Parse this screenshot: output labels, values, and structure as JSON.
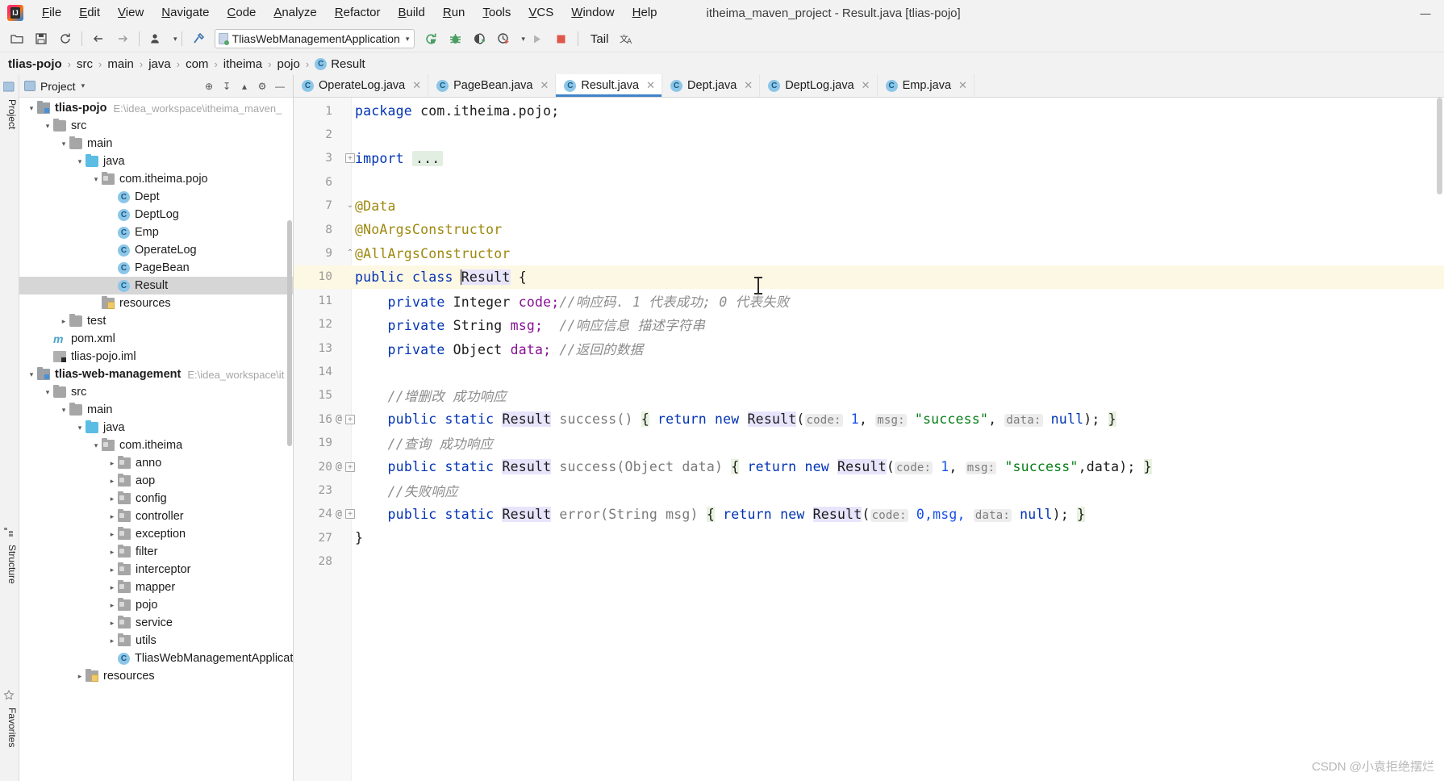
{
  "window": {
    "title": "itheima_maven_project - Result.java [tlias-pojo]",
    "controls": {
      "minimize": "—",
      "maximize": "□",
      "close": "✕"
    }
  },
  "menubar": [
    {
      "label": "File"
    },
    {
      "label": "Edit"
    },
    {
      "label": "View"
    },
    {
      "label": "Navigate"
    },
    {
      "label": "Code"
    },
    {
      "label": "Analyze"
    },
    {
      "label": "Refactor"
    },
    {
      "label": "Build"
    },
    {
      "label": "Run"
    },
    {
      "label": "Tools"
    },
    {
      "label": "VCS"
    },
    {
      "label": "Window"
    },
    {
      "label": "Help"
    }
  ],
  "toolbar": {
    "icons_left": [
      {
        "name": "open-folder-icon",
        "glyph": "📂"
      },
      {
        "name": "save-all-icon",
        "glyph": "💾"
      },
      {
        "name": "sync-refresh-icon",
        "glyph": "↻"
      },
      {
        "name": "back-icon",
        "glyph": "←"
      },
      {
        "name": "forward-icon",
        "glyph": "→"
      },
      {
        "name": "user-profile-icon",
        "glyph": "👤"
      },
      {
        "name": "build-hammer-icon",
        "glyph": "⬉"
      }
    ],
    "run_config": "TliasWebManagementApplication",
    "icons_right": [
      {
        "name": "run-arrow-icon",
        "glyph": "➳"
      },
      {
        "name": "debug-bug-icon",
        "glyph": "🐞"
      },
      {
        "name": "run-with-coverage-icon",
        "glyph": "◑"
      },
      {
        "name": "profiler-clock-icon",
        "glyph": "⒬"
      },
      {
        "name": "dropdown-caret-icon",
        "glyph": "▾"
      },
      {
        "name": "play-icon",
        "glyph": "▶"
      },
      {
        "name": "stop-square-icon",
        "glyph": "■"
      }
    ],
    "tail_label": "Tail",
    "translate_label": "文A"
  },
  "breadcrumb": [
    {
      "label": "tlias-pojo",
      "bold": true,
      "icon": null
    },
    {
      "label": "src",
      "bold": false,
      "icon": null
    },
    {
      "label": "main",
      "bold": false,
      "icon": null
    },
    {
      "label": "java",
      "bold": false,
      "icon": null
    },
    {
      "label": "com",
      "bold": false,
      "icon": null
    },
    {
      "label": "itheima",
      "bold": false,
      "icon": null
    },
    {
      "label": "pojo",
      "bold": false,
      "icon": null
    },
    {
      "label": "Result",
      "bold": false,
      "icon": "class-icon"
    }
  ],
  "left_rail": [
    {
      "label": "Project",
      "name": "rail-tab-project"
    },
    {
      "label": "Structure",
      "name": "rail-tab-structure"
    },
    {
      "label": "Favorites",
      "name": "rail-tab-favorites"
    }
  ],
  "project_panel": {
    "title": "Project",
    "header_buttons": [
      {
        "name": "locate-target-icon",
        "glyph": "⊕"
      },
      {
        "name": "collapse-all-icon",
        "glyph": "↧"
      },
      {
        "name": "expand-icon",
        "glyph": "▴"
      },
      {
        "name": "settings-gear-icon",
        "glyph": "⚙"
      },
      {
        "name": "hide-panel-icon",
        "glyph": "—"
      }
    ],
    "tree": [
      {
        "indent": 0,
        "arrow": "down",
        "icon": "module",
        "label": "tlias-pojo",
        "bold": true,
        "path": "E:\\idea_workspace\\itheima_maven_",
        "selected": false
      },
      {
        "indent": 1,
        "arrow": "down",
        "icon": "folder",
        "label": "src",
        "bold": false,
        "path": "",
        "selected": false
      },
      {
        "indent": 2,
        "arrow": "down",
        "icon": "folder",
        "label": "main",
        "bold": false,
        "path": "",
        "selected": false
      },
      {
        "indent": 3,
        "arrow": "down",
        "icon": "folder-blue",
        "label": "java",
        "bold": false,
        "path": "",
        "selected": false
      },
      {
        "indent": 4,
        "arrow": "down",
        "icon": "package",
        "label": "com.itheima.pojo",
        "bold": false,
        "path": "",
        "selected": false
      },
      {
        "indent": 5,
        "arrow": "none",
        "icon": "class",
        "label": "Dept",
        "bold": false,
        "path": "",
        "selected": false
      },
      {
        "indent": 5,
        "arrow": "none",
        "icon": "class",
        "label": "DeptLog",
        "bold": false,
        "path": "",
        "selected": false
      },
      {
        "indent": 5,
        "arrow": "none",
        "icon": "class",
        "label": "Emp",
        "bold": false,
        "path": "",
        "selected": false
      },
      {
        "indent": 5,
        "arrow": "none",
        "icon": "class",
        "label": "OperateLog",
        "bold": false,
        "path": "",
        "selected": false
      },
      {
        "indent": 5,
        "arrow": "none",
        "icon": "class",
        "label": "PageBean",
        "bold": false,
        "path": "",
        "selected": false
      },
      {
        "indent": 5,
        "arrow": "none",
        "icon": "class",
        "label": "Result",
        "bold": false,
        "path": "",
        "selected": true
      },
      {
        "indent": 4,
        "arrow": "none",
        "icon": "resources",
        "label": "resources",
        "bold": false,
        "path": "",
        "selected": false
      },
      {
        "indent": 2,
        "arrow": "right",
        "icon": "folder",
        "label": "test",
        "bold": false,
        "path": "",
        "selected": false
      },
      {
        "indent": 1,
        "arrow": "none",
        "icon": "maven",
        "label": "pom.xml",
        "bold": false,
        "path": "",
        "selected": false
      },
      {
        "indent": 1,
        "arrow": "none",
        "icon": "iml",
        "label": "tlias-pojo.iml",
        "bold": false,
        "path": "",
        "selected": false
      },
      {
        "indent": 0,
        "arrow": "down",
        "icon": "module",
        "label": "tlias-web-management",
        "bold": true,
        "path": "E:\\idea_workspace\\it",
        "selected": false
      },
      {
        "indent": 1,
        "arrow": "down",
        "icon": "folder",
        "label": "src",
        "bold": false,
        "path": "",
        "selected": false
      },
      {
        "indent": 2,
        "arrow": "down",
        "icon": "folder",
        "label": "main",
        "bold": false,
        "path": "",
        "selected": false
      },
      {
        "indent": 3,
        "arrow": "down",
        "icon": "folder-blue",
        "label": "java",
        "bold": false,
        "path": "",
        "selected": false
      },
      {
        "indent": 4,
        "arrow": "down",
        "icon": "package",
        "label": "com.itheima",
        "bold": false,
        "path": "",
        "selected": false
      },
      {
        "indent": 5,
        "arrow": "right",
        "icon": "package",
        "label": "anno",
        "bold": false,
        "path": "",
        "selected": false
      },
      {
        "indent": 5,
        "arrow": "right",
        "icon": "package",
        "label": "aop",
        "bold": false,
        "path": "",
        "selected": false
      },
      {
        "indent": 5,
        "arrow": "right",
        "icon": "package",
        "label": "config",
        "bold": false,
        "path": "",
        "selected": false
      },
      {
        "indent": 5,
        "arrow": "right",
        "icon": "package",
        "label": "controller",
        "bold": false,
        "path": "",
        "selected": false
      },
      {
        "indent": 5,
        "arrow": "right",
        "icon": "package",
        "label": "exception",
        "bold": false,
        "path": "",
        "selected": false
      },
      {
        "indent": 5,
        "arrow": "right",
        "icon": "package",
        "label": "filter",
        "bold": false,
        "path": "",
        "selected": false
      },
      {
        "indent": 5,
        "arrow": "right",
        "icon": "package",
        "label": "interceptor",
        "bold": false,
        "path": "",
        "selected": false
      },
      {
        "indent": 5,
        "arrow": "right",
        "icon": "package",
        "label": "mapper",
        "bold": false,
        "path": "",
        "selected": false
      },
      {
        "indent": 5,
        "arrow": "right",
        "icon": "package",
        "label": "pojo",
        "bold": false,
        "path": "",
        "selected": false
      },
      {
        "indent": 5,
        "arrow": "right",
        "icon": "package",
        "label": "service",
        "bold": false,
        "path": "",
        "selected": false
      },
      {
        "indent": 5,
        "arrow": "right",
        "icon": "package",
        "label": "utils",
        "bold": false,
        "path": "",
        "selected": false
      },
      {
        "indent": 5,
        "arrow": "none",
        "icon": "class",
        "label": "TliasWebManagementApplicat",
        "bold": false,
        "path": "",
        "selected": false
      },
      {
        "indent": 3,
        "arrow": "right",
        "icon": "resources",
        "label": "resources",
        "bold": false,
        "path": "",
        "selected": false
      }
    ]
  },
  "editor_tabs": [
    {
      "label": "OperateLog.java",
      "active": false
    },
    {
      "label": "PageBean.java",
      "active": false
    },
    {
      "label": "Result.java",
      "active": true
    },
    {
      "label": "Dept.java",
      "active": false
    },
    {
      "label": "DeptLog.java",
      "active": false
    },
    {
      "label": "Emp.java",
      "active": false
    }
  ],
  "code": {
    "file": "Result.java",
    "lines": [
      {
        "num": "1",
        "gutter": "",
        "fold": "",
        "highlight": false
      },
      {
        "num": "2",
        "gutter": "",
        "fold": "",
        "highlight": false
      },
      {
        "num": "3",
        "gutter": "",
        "fold": "plus",
        "highlight": false
      },
      {
        "num": "6",
        "gutter": "",
        "fold": "",
        "highlight": false
      },
      {
        "num": "7",
        "gutter": "",
        "fold": "minus",
        "highlight": false
      },
      {
        "num": "8",
        "gutter": "",
        "fold": "",
        "highlight": false
      },
      {
        "num": "9",
        "gutter": "",
        "fold": "end",
        "highlight": false
      },
      {
        "num": "10",
        "gutter": "",
        "fold": "",
        "highlight": true
      },
      {
        "num": "11",
        "gutter": "",
        "fold": "",
        "highlight": false
      },
      {
        "num": "12",
        "gutter": "",
        "fold": "",
        "highlight": false
      },
      {
        "num": "13",
        "gutter": "",
        "fold": "",
        "highlight": false
      },
      {
        "num": "14",
        "gutter": "",
        "fold": "",
        "highlight": false
      },
      {
        "num": "15",
        "gutter": "",
        "fold": "",
        "highlight": false
      },
      {
        "num": "16",
        "gutter": "@",
        "fold": "plus",
        "highlight": false
      },
      {
        "num": "19",
        "gutter": "",
        "fold": "",
        "highlight": false
      },
      {
        "num": "20",
        "gutter": "@",
        "fold": "plus",
        "highlight": false
      },
      {
        "num": "23",
        "gutter": "",
        "fold": "",
        "highlight": false
      },
      {
        "num": "24",
        "gutter": "@",
        "fold": "plus",
        "highlight": false
      },
      {
        "num": "27",
        "gutter": "",
        "fold": "",
        "highlight": false
      },
      {
        "num": "28",
        "gutter": "",
        "fold": "",
        "highlight": false
      }
    ],
    "text": {
      "l1_package_kw": "package",
      "l1_pkgname": " com.itheima.pojo;",
      "l3_import_kw": "import",
      "l3_fold": "...",
      "l7_data": "@Data",
      "l8_noargs": "@NoArgsConstructor",
      "l9_allargs": "@AllArgsConstructor",
      "l10_public": "public",
      "l10_class": "class",
      "l10_name": "Result",
      "l10_brace": "{",
      "l11_private": "private",
      "l11_type": "Integer",
      "l11_field": "code;",
      "l11_comment": "//响应码. 1 代表成功; 0 代表失败",
      "l12_private": "private",
      "l12_type": "String",
      "l12_field": "msg;",
      "l12_comment": "//响应信息 描述字符串",
      "l13_private": "private",
      "l13_type": "Object",
      "l13_field": "data;",
      "l13_comment": "//返回的数据",
      "l15_comment": "//增删改 成功响应",
      "l16_public": "public",
      "l16_static": "static",
      "l16_rettype": "Result",
      "l16_method": "success()",
      "l16_obrace": "{",
      "l16_return": "return",
      "l16_new": "new",
      "l16_ctor": "Result",
      "l16_paren": "(",
      "l16_hint_code": "code:",
      "l16_code_val": "1",
      "l16_hint_msg": "msg:",
      "l16_msg_val": "\"success\"",
      "l16_hint_data": "data:",
      "l16_data_val": "null",
      "l16_end": "); ",
      "l16_cbrace": "}",
      "l19_comment": "//查询 成功响应",
      "l20_public": "public",
      "l20_static": "static",
      "l20_rettype": "Result",
      "l20_method": "success(Object data)",
      "l20_obrace": "{",
      "l20_return": "return",
      "l20_new": "new",
      "l20_ctor": "Result",
      "l20_paren": "(",
      "l20_hint_code": "code:",
      "l20_code_val": "1",
      "l20_hint_msg": "msg:",
      "l20_msg_val": "\"success\"",
      "l20_data_arg": ",data",
      "l20_end": "); ",
      "l20_cbrace": "}",
      "l23_comment": "//失败响应",
      "l24_public": "public",
      "l24_static": "static",
      "l24_rettype": "Result",
      "l24_method": "error(String msg)",
      "l24_obrace": "{",
      "l24_return": "return",
      "l24_new": "new",
      "l24_ctor": "Result",
      "l24_paren": "(",
      "l24_hint_code": "code:",
      "l24_code_val": "0,msg,",
      "l24_hint_data": "data:",
      "l24_data_val": "null",
      "l24_end": "); ",
      "l24_cbrace": "}",
      "l27_close": "}"
    }
  },
  "watermark": "CSDN @小袁拒绝摆烂"
}
